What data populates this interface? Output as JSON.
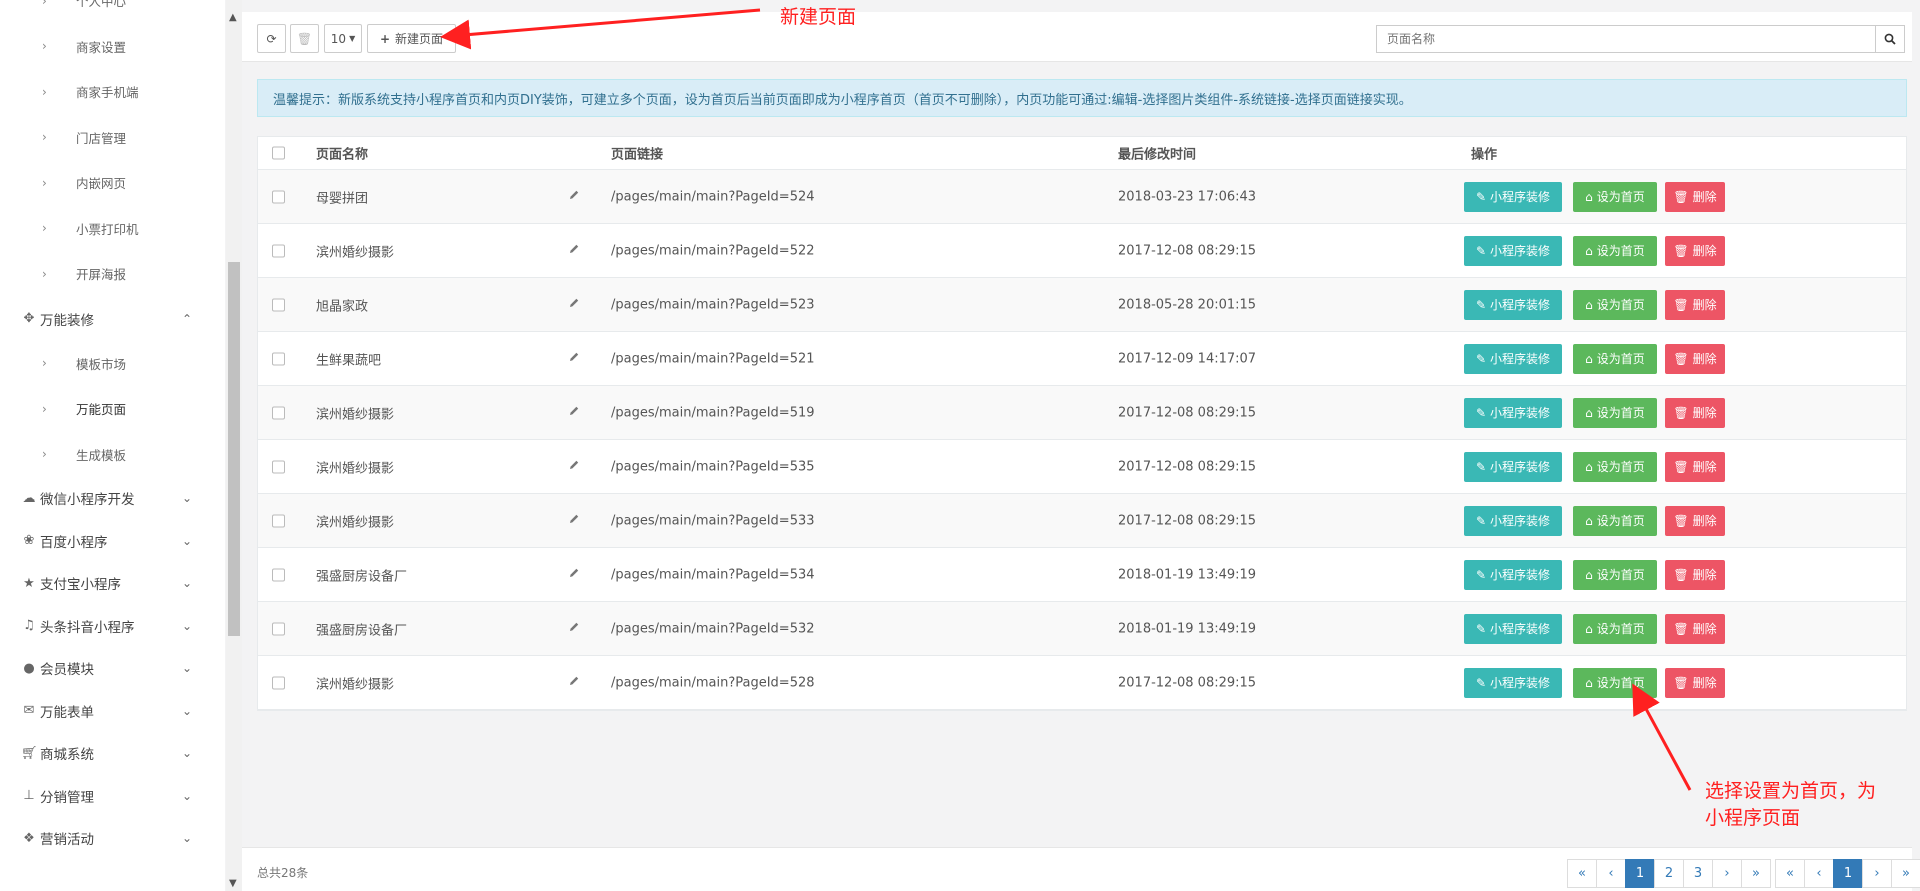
{
  "sidebar": {
    "top_items": [
      "个人中心",
      "商家设置",
      "商家手机端",
      "门店管理",
      "内嵌网页",
      "小票打印机",
      "开屏海报"
    ],
    "section": {
      "label": "万能装修",
      "icon": "move-icon"
    },
    "section_items": [
      "模板市场",
      "万能页面",
      "生成模板"
    ],
    "active_item": "万能页面",
    "groups": [
      {
        "label": "微信小程序开发",
        "icon": "wechat-icon"
      },
      {
        "label": "百度小程序",
        "icon": "paw-icon"
      },
      {
        "label": "支付宝小程序",
        "icon": "star-icon"
      },
      {
        "label": "头条抖音小程序",
        "icon": "music-icon"
      },
      {
        "label": "会员模块",
        "icon": "user-icon"
      },
      {
        "label": "万能表单",
        "icon": "envelope-icon"
      },
      {
        "label": "商城系统",
        "icon": "cart-icon"
      },
      {
        "label": "分销管理",
        "icon": "sitemap-icon"
      },
      {
        "label": "营销活动",
        "icon": "gift-icon"
      }
    ]
  },
  "toolbar": {
    "page_size": "10",
    "new_page_label": "新建页面",
    "search_placeholder": "页面名称"
  },
  "notice": "温馨提示：新版系统支持小程序首页和内页DIY装饰，可建立多个页面，设为首页后当前页面即成为小程序首页（首页不可删除），内页功能可通过:编辑-选择图片类组件-系统链接-选择页面链接实现。",
  "table": {
    "headers": [
      "页面名称",
      "页面链接",
      "最后修改时间",
      "操作"
    ],
    "actions": {
      "decorate": "小程序装修",
      "set_home": "设为首页",
      "delete": "删除"
    },
    "rows": [
      {
        "name": "母婴拼团",
        "link": "/pages/main/main?PageId=524",
        "time": "2018-03-23 17:06:43"
      },
      {
        "name": "滨州婚纱摄影",
        "link": "/pages/main/main?PageId=522",
        "time": "2017-12-08 08:29:15"
      },
      {
        "name": "旭晶家政",
        "link": "/pages/main/main?PageId=523",
        "time": "2018-05-28 20:01:15"
      },
      {
        "name": "生鲜果蔬吧",
        "link": "/pages/main/main?PageId=521",
        "time": "2017-12-09 14:17:07"
      },
      {
        "name": "滨州婚纱摄影",
        "link": "/pages/main/main?PageId=519",
        "time": "2017-12-08 08:29:15"
      },
      {
        "name": "滨州婚纱摄影",
        "link": "/pages/main/main?PageId=535",
        "time": "2017-12-08 08:29:15"
      },
      {
        "name": "滨州婚纱摄影",
        "link": "/pages/main/main?PageId=533",
        "time": "2017-12-08 08:29:15"
      },
      {
        "name": "强盛厨房设备厂",
        "link": "/pages/main/main?PageId=534",
        "time": "2018-01-19 13:49:19"
      },
      {
        "name": "强盛厨房设备厂",
        "link": "/pages/main/main?PageId=532",
        "time": "2018-01-19 13:49:19"
      },
      {
        "name": "滨州婚纱摄影",
        "link": "/pages/main/main?PageId=528",
        "time": "2017-12-08 08:29:15"
      }
    ]
  },
  "footer": {
    "total": "总共28条",
    "pager1": [
      "«",
      "‹",
      "1",
      "2",
      "3",
      "›",
      "»"
    ],
    "pager2": [
      "«",
      "‹",
      "1",
      "›",
      "»"
    ]
  },
  "annotations": {
    "new_page": "新建页面",
    "set_home_line1": "选择设置为首页，为",
    "set_home_line2": "小程序页面"
  },
  "colors": {
    "decorate": "#3ab8b5",
    "set_home": "#5cb85c",
    "delete": "#ed5565",
    "annotation": "#ff2020",
    "pager_active": "#337ab7"
  }
}
